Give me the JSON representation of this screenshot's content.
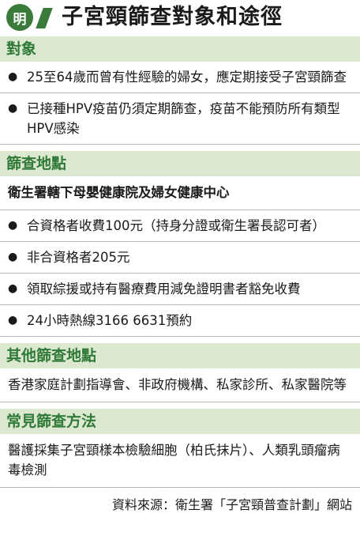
{
  "header": {
    "badge": "明",
    "title": "子宮頸篩查對象和途徑",
    "accent_color": "#3a7a3a"
  },
  "sections": {
    "targets": {
      "heading": "對象",
      "items": [
        "25至64歲而曾有性經驗的婦女，應定期接受子宮頸篩查",
        "已接種HPV疫苗仍須定期篩查，疫苗不能預防所有類型HPV感染"
      ]
    },
    "locations": {
      "heading": "篩查地點",
      "subheading": "衛生署轄下母嬰健康院及婦女健康中心",
      "items": [
        "合資格者收費100元（持身分證或衛生署長認可者）",
        "非合資格者205元",
        "領取綜援或持有醫療費用減免證明書者豁免收費",
        "24小時熱線3166 6631預約"
      ]
    },
    "other_locations": {
      "heading": "其他篩查地點",
      "text": "香港家庭計劃指導會、非政府機構、私家診所、私家醫院等"
    },
    "methods": {
      "heading": "常見篩查方法",
      "text": "醫護採集子宮頸樣本檢驗細胞（柏氏抹片）、人類乳頭瘤病毒檢測"
    }
  },
  "footer": {
    "source": "資料來源：衛生署「子宮頸普查計劃」網站"
  },
  "colors": {
    "band_background": "#dde8d0",
    "band_text": "#2f7a38"
  }
}
